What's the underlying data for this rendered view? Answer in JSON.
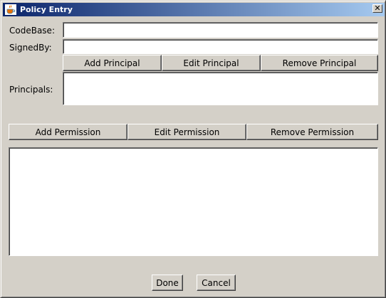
{
  "window": {
    "title": "Policy Entry",
    "close_symbol": "✕"
  },
  "icons": {
    "title_icon": "java-cup-icon",
    "close": "close-icon"
  },
  "fields": {
    "codebase": {
      "label": "CodeBase:",
      "value": ""
    },
    "signedby": {
      "label": "SignedBy:",
      "value": ""
    },
    "principals": {
      "label": "Principals:"
    }
  },
  "principal_buttons": {
    "add": "Add Principal",
    "edit": "Edit Principal",
    "remove": "Remove Principal"
  },
  "permission_buttons": {
    "add": "Add Permission",
    "edit": "Edit Permission",
    "remove": "Remove Permission"
  },
  "footer": {
    "done": "Done",
    "cancel": "Cancel"
  }
}
